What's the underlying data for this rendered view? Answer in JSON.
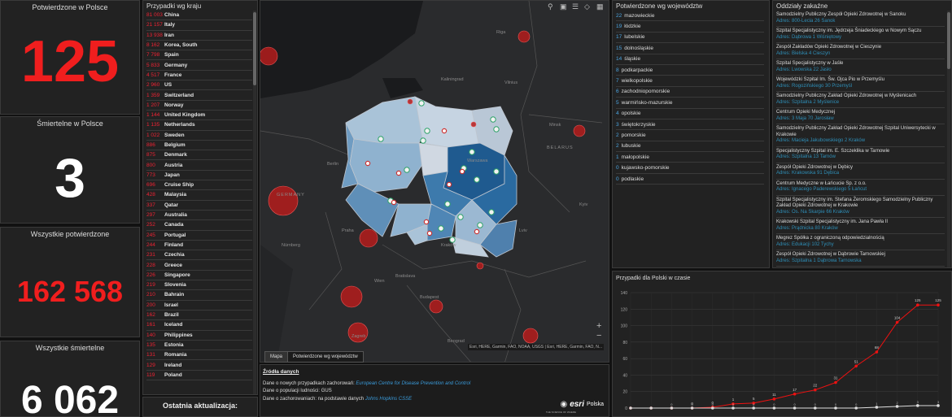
{
  "confirmed_pl": {
    "title": "Potwierdzone w Polsce",
    "value": "125"
  },
  "deaths_pl": {
    "title": "Śmiertelne w Polsce",
    "value": "3"
  },
  "confirmed_all": {
    "title": "Wszystkie potwierdzone",
    "value": "162 568"
  },
  "deaths_all": {
    "title": "Wszystkie śmiertelne",
    "value": "6 062"
  },
  "countries": {
    "title": "Przypadki wg kraju",
    "items": [
      {
        "n": "81 003",
        "c": "China"
      },
      {
        "n": "21 157",
        "c": "Italy"
      },
      {
        "n": "13 938",
        "c": "Iran"
      },
      {
        "n": "8 162",
        "c": "Korea, South"
      },
      {
        "n": "7 798",
        "c": "Spain"
      },
      {
        "n": "5 833",
        "c": "Germany"
      },
      {
        "n": "4 517",
        "c": "France"
      },
      {
        "n": "2 960",
        "c": "US"
      },
      {
        "n": "1 359",
        "c": "Switzerland"
      },
      {
        "n": "1 207",
        "c": "Norway"
      },
      {
        "n": "1 144",
        "c": "United Kingdom"
      },
      {
        "n": "1 135",
        "c": "Netherlands"
      },
      {
        "n": "1 022",
        "c": "Sweden"
      },
      {
        "n": "886",
        "c": "Belgium"
      },
      {
        "n": "875",
        "c": "Denmark"
      },
      {
        "n": "800",
        "c": "Austria"
      },
      {
        "n": "773",
        "c": "Japan"
      },
      {
        "n": "696",
        "c": "Cruise Ship"
      },
      {
        "n": "428",
        "c": "Malaysia"
      },
      {
        "n": "337",
        "c": "Qatar"
      },
      {
        "n": "297",
        "c": "Australia"
      },
      {
        "n": "252",
        "c": "Canada"
      },
      {
        "n": "245",
        "c": "Portugal"
      },
      {
        "n": "244",
        "c": "Finland"
      },
      {
        "n": "231",
        "c": "Czechia"
      },
      {
        "n": "228",
        "c": "Greece"
      },
      {
        "n": "226",
        "c": "Singapore"
      },
      {
        "n": "219",
        "c": "Slovenia"
      },
      {
        "n": "210",
        "c": "Bahrain"
      },
      {
        "n": "200",
        "c": "Israel"
      },
      {
        "n": "162",
        "c": "Brazil"
      },
      {
        "n": "161",
        "c": "Iceland"
      },
      {
        "n": "140",
        "c": "Philippines"
      },
      {
        "n": "135",
        "c": "Estonia"
      },
      {
        "n": "131",
        "c": "Romania"
      },
      {
        "n": "129",
        "c": "Ireland"
      },
      {
        "n": "119",
        "c": "Poland"
      }
    ],
    "footer": "Ostatnia aktualizacja:"
  },
  "voiv": {
    "title": "Potwierdzone wg województw",
    "items": [
      {
        "n": "22",
        "v": "mazowieckie"
      },
      {
        "n": "19",
        "v": "łódzkie"
      },
      {
        "n": "17",
        "v": "lubelskie"
      },
      {
        "n": "15",
        "v": "dolnośląskie"
      },
      {
        "n": "14",
        "v": "śląskie"
      },
      {
        "n": "8",
        "v": "podkarpackie"
      },
      {
        "n": "7",
        "v": "wielkopolskie"
      },
      {
        "n": "6",
        "v": "zachodniopomorskie"
      },
      {
        "n": "5",
        "v": "warmińsko-mazurskie"
      },
      {
        "n": "4",
        "v": "opolskie"
      },
      {
        "n": "3",
        "v": "świętokrzyskie"
      },
      {
        "n": "2",
        "v": "pomorskie"
      },
      {
        "n": "2",
        "v": "lubuskie"
      },
      {
        "n": "1",
        "v": "małopolskie"
      },
      {
        "n": "0",
        "v": "kujawsko-pomorskie"
      },
      {
        "n": "0",
        "v": "podlaskie"
      }
    ]
  },
  "hospitals": {
    "title": "Oddziały zakaźne",
    "items": [
      {
        "name": "Samodzielny Publiczny Zespół Opieki Zdrowotnej w Sanoku",
        "addr": "Adres: 800-Lecia 26 Sanok"
      },
      {
        "name": "Szpital Specjalistyczny im. Jędrzeja Śniadeckiego w Nowym Sączu",
        "addr": "Adres: Dąbrowa 1 Wiśniętowy"
      },
      {
        "name": "Zespół Zakładów Opieki Zdrowotnej w Cieszynie",
        "addr": "Adres: Bielska 4 Cieszyn"
      },
      {
        "name": "Szpital Specjalistyczny w Jaśle",
        "addr": "Adres: Lwowska 22 Jasło"
      },
      {
        "name": "Wojewódzki Szpital Im. Św. Ojca Pio w Przemyślu",
        "addr": "Adres: Rogozińskiego 30 Przemyśl"
      },
      {
        "name": "Samodzielny Publiczny Zakład Opieki Zdrowotnej w Myślenicach",
        "addr": "Adres: Szpitalna 2 Myślenice"
      },
      {
        "name": "Centrum Opieki Medycznej",
        "addr": "Adres: 3 Maja 70 Jarosław"
      },
      {
        "name": "Samodzielny Publiczny Zakład Opieki Zdrowotnej Szpital Uniwersytecki w Krakowie",
        "addr": "Adres: Macieja Jakubowskiego 2 Kraków"
      },
      {
        "name": "Specjalistyczny Szpital im. E. Szczeklika w Tarnowie",
        "addr": "Adres: Szpitalna 13 Tarnów"
      },
      {
        "name": "Zespół Opieki Zdrowotnej w Dębicy",
        "addr": "Adres: Krakowska 91 Dębica"
      },
      {
        "name": "Centrum Medyczne w Łańcucie Sp. z o.o.",
        "addr": "Adres: Ignacego Paderewskiego 5 Łańcut"
      },
      {
        "name": "Szpital Specjalistyczny im. Stefana Żeromskiego Samodzielny Publiczny Zakład Opieki Zdrowotnej w Krakowie",
        "addr": "Adres: Os. Na Skarpie 66 Kraków"
      },
      {
        "name": "Krakowski Szpital Specjalistyczny im. Jana Pawła II",
        "addr": "Adres: Prądnicka 80 Kraków"
      },
      {
        "name": "Megrez Spółka z ograniczoną odpowiedzialnością",
        "addr": "Adres: Edukacji 102 Tychy"
      },
      {
        "name": "Zespół Opieki Zdrowotnej w Dąbrowie Tarnowskiej",
        "addr": "Adres: Szpitalna 1 Dąbrowa Tarnowska"
      }
    ]
  },
  "map": {
    "tabs": [
      "Mapa",
      "Potwierdzone wg województw"
    ],
    "attribution": "Esri, HERE, Garmin, FAO, NOAA, USGS | Esri, HERE, Garmin, FAO, N...",
    "labels": [
      "Minsk",
      "BELARUS",
      "Berlin",
      "GERMANY",
      "Praha",
      "Warszawa",
      "Kraków",
      "Budapest",
      "Wien",
      "Nürnberg",
      "Zagreb",
      "Bratislava",
      "Beograd",
      "Kaliningrad",
      "Vilnius",
      "Riga",
      "Lviv",
      "Kyiv"
    ],
    "zoom_in": "+",
    "zoom_out": "−"
  },
  "sources": {
    "title": "Źródła danych",
    "lines": [
      {
        "pre": "Dane o nowych przypadkach zachorowań: ",
        "link": "European Centre for Disease Prevention and Control"
      },
      {
        "pre": "Dane o populacji ludności: GUS",
        "link": ""
      },
      {
        "pre": "Dane o zachorowaniach: na podstawie danych ",
        "link": "Johns Hopkins CSSE"
      }
    ],
    "brand": "esri",
    "brand2": "Polska",
    "tagline": "THE SCIENCE OF WHERE"
  },
  "chart": {
    "title": "Przypadki dla Polski w czasie"
  },
  "chart_data": {
    "type": "line",
    "title": "Przypadki dla Polski w czasie",
    "ylim": [
      0,
      140
    ],
    "yticks": [
      0,
      20,
      40,
      60,
      80,
      100,
      120,
      140
    ],
    "grid": true,
    "series": [
      {
        "values": [
          0,
          0,
          0,
          0,
          1,
          5,
          6,
          11,
          17,
          22,
          31,
          51,
          68,
          104,
          125,
          125
        ],
        "color": "#e11"
      },
      {
        "values": [
          0,
          0,
          0,
          0,
          0,
          0,
          0,
          0,
          0,
          0,
          0,
          0,
          1,
          2,
          3,
          3
        ],
        "color": "#ddd"
      }
    ],
    "labels_red": [
      "0",
      "0",
      "1",
      "5",
      "11",
      "17",
      "22",
      "31",
      "51",
      "68",
      "104",
      "125",
      "125"
    ],
    "labels_white": [
      "0",
      "0",
      "0",
      "0",
      "0",
      "0",
      "0",
      "0",
      "0",
      "0",
      "1",
      "2",
      "3",
      "3"
    ]
  },
  "colors": {
    "accent_red": "#e22222",
    "link_blue": "#3a9ad9"
  }
}
